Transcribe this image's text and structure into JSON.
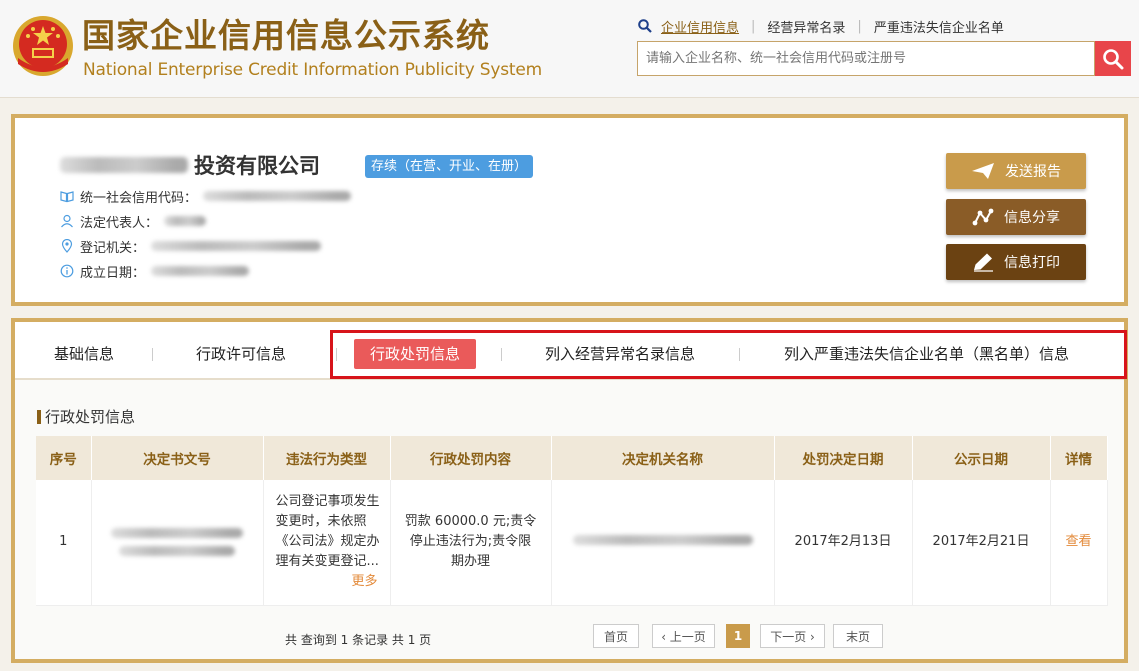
{
  "header": {
    "title_cn": "国家企业信用信息公示系统",
    "title_en": "National Enterprise Credit Information Publicity System",
    "nav": [
      "企业信用信息",
      "经营异常名录",
      "严重违法失信企业名单"
    ],
    "search_placeholder": "请输入企业名称、统一社会信用代码或注册号"
  },
  "company": {
    "name_suffix": "投资有限公司",
    "status": "存续（在营、开业、在册）",
    "fields": {
      "credit_code_label": "统一社会信用代码：",
      "legal_rep_label": "法定代表人：",
      "authority_label": "登记机关：",
      "founded_label": "成立日期："
    },
    "actions": {
      "send_report": "发送报告",
      "share": "信息分享",
      "print": "信息打印"
    }
  },
  "tabs": [
    "基础信息",
    "行政许可信息",
    "行政处罚信息",
    "列入经营异常名录信息",
    "列入严重违法失信企业名单（黑名单）信息"
  ],
  "active_tab_index": 2,
  "section_title": "行政处罚信息",
  "table": {
    "headers": [
      "序号",
      "决定书文号",
      "违法行为类型",
      "行政处罚内容",
      "决定机关名称",
      "处罚决定日期",
      "公示日期",
      "详情"
    ],
    "rows": [
      {
        "index": "1",
        "violation": "公司登记事项发生变更时，未依照《公司法》规定办理有关变更登记...",
        "more": "更多",
        "penalty": "罚款 60000.0 元;责令停止违法行为;责令限期办理",
        "decision_date": "2017年2月13日",
        "publish_date": "2017年2月21日",
        "detail": "查看"
      }
    ]
  },
  "footer": {
    "count_text": "共 查询到 1 条记录 共 1 页",
    "pager": {
      "first": "首页",
      "prev": "‹ 上一页",
      "current": "1",
      "next": "下一页 ›",
      "last": "末页"
    }
  },
  "colors": {
    "gold": "#d4ad62",
    "brand": "#8a6017",
    "active_tab": "#ea5a5a",
    "status_badge": "#4d9de0",
    "highlight_frame": "#d7141a"
  }
}
